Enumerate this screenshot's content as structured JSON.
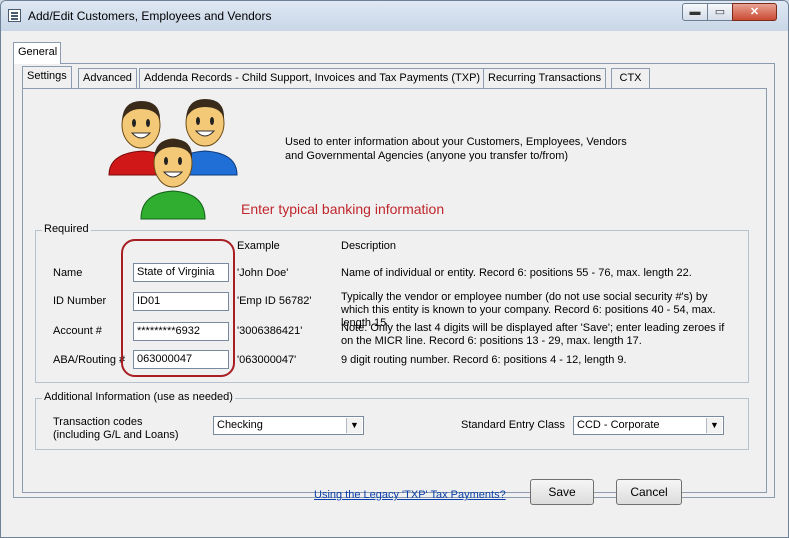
{
  "window": {
    "title": "Add/Edit Customers, Employees and Vendors",
    "minimize": "▬",
    "maximize": "▭",
    "close": "✕"
  },
  "top_tabs": [
    "General"
  ],
  "sub_tabs": [
    "Settings",
    "Advanced",
    "Addenda Records - Child Support, Invoices and Tax Payments (TXP)",
    "Recurring Transactions",
    "CTX"
  ],
  "intro_text": "Used to enter information about your Customers, Employees, Vendors and Governmental Agencies (anyone you transfer to/from)",
  "hint_text": "Enter typical banking information",
  "required": {
    "legend": "Required",
    "col_example": "Example",
    "col_description": "Description",
    "rows": [
      {
        "label": "Name",
        "value": "State of Virginia",
        "example": "'John Doe'",
        "description": "Name of individual or entity. Record 6: positions 55 - 76, max. length 22."
      },
      {
        "label": "ID Number",
        "value": "ID01",
        "example": "'Emp ID 56782'",
        "description": "Typically the vendor or employee number (do not use social security #'s) by which this entity is known to your company. Record 6: positions 40 - 54, max. length 15."
      },
      {
        "label": "Account #",
        "value": "*********6932",
        "example": "'3006386421'",
        "description": "Note: Only the last 4 digits will be displayed after 'Save'; enter leading zeroes if on the MICR line. Record 6: positions 13 - 29, max. length 17."
      },
      {
        "label": "ABA/Routing #",
        "value": "063000047",
        "example": "'063000047'",
        "description": "9 digit routing number. Record 6: positions 4 - 12, length 9."
      }
    ]
  },
  "additional": {
    "legend": "Additional Information (use as needed)",
    "transaction_codes_label": "Transaction codes\n(including G/L and Loans)",
    "transaction_codes_line1": "Transaction codes",
    "transaction_codes_line2": "(including G/L and Loans)",
    "transaction_codes_value": "Checking",
    "sec_label": "Standard Entry Class",
    "sec_value": "CCD - Corporate"
  },
  "footer": {
    "legacy_link": "Using the Legacy 'TXP' Tax Payments?",
    "save": "Save",
    "cancel": "Cancel"
  }
}
